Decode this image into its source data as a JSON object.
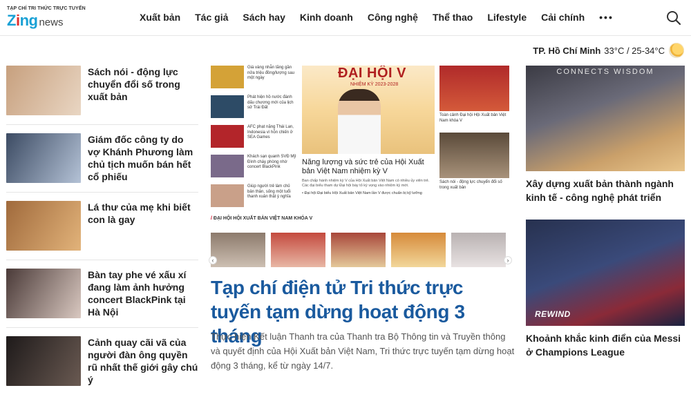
{
  "header": {
    "logo_tag": "TẠP CHÍ TRI THỨC TRỰC TUYẾN",
    "logo_brand_z": "Z",
    "logo_brand_i": "i",
    "logo_brand_ng": "ng",
    "logo_news": "news",
    "nav": [
      "Xuất bản",
      "Tác giả",
      "Sách hay",
      "Kinh doanh",
      "Công nghệ",
      "Thể thao",
      "Lifestyle",
      "Cải chính"
    ],
    "more": "•••"
  },
  "weather": {
    "city": "TP. Hồ Chí Minh",
    "temp": "33°C / 25-34°C"
  },
  "left_news": [
    {
      "title": "Sách nói - động lực chuyển đổi số trong xuất bản",
      "colors": [
        "#c7a07e",
        "#e9d6c3"
      ]
    },
    {
      "title": "Giám đốc công ty do vợ Khánh Phương làm chủ tịch muốn bán hết cổ phiếu",
      "colors": [
        "#3c4b63",
        "#b4c2d6"
      ]
    },
    {
      "title": "Lá thư của mẹ khi biết con là gay",
      "colors": [
        "#a06a3c",
        "#e2b37a"
      ]
    },
    {
      "title": "Bàn tay phe vé xấu xí đang làm ảnh hưởng concert BlackPink tại Hà Nội",
      "colors": [
        "#4a3a38",
        "#d9c8c0"
      ]
    },
    {
      "title": "Cảnh quay cãi vã của người đàn ông quyền rũ nhất thế giới gây chú ý",
      "colors": [
        "#1e1a1a",
        "#6a5a52"
      ]
    }
  ],
  "mini_news": [
    {
      "text": "Giá vàng nhẫn tăng gần nửa triệu đồng/lượng sau một ngày",
      "color": "#d4a237"
    },
    {
      "text": "Phát hiện hồ nước đánh dấu chương mới của lịch sử Trái Đất",
      "color": "#2d4b66"
    },
    {
      "text": "AFC phạt nặng Thái Lan, Indonesia vì hỗn chiến ở SEA Games",
      "color": "#b3252a"
    },
    {
      "text": "Khách sạn quanh SVĐ Mỹ Đình cháy phòng nhờ concert BlackPink",
      "color": "#7a6a8a"
    },
    {
      "text": "Giúp người trẻ làm chủ bản thân, sống một tuổi thanh xuân thật ý nghĩa",
      "color": "#c9a089"
    }
  ],
  "feature": {
    "banner": "ĐẠI HỘI V",
    "banner_sub": "NHIỆM KỲ 2023-2028",
    "title": "Năng lượng và sức trẻ của Hội Xuất bản Việt Nam nhiệm kỳ V",
    "desc": "Ban chấp hành nhiệm kỳ V của Hội Xuất bản Việt Nam có nhiều ủy viên trẻ. Các đại biểu tham dự Đại hội bày tỏ kỳ vọng vào nhiệm kỳ mới.",
    "bullet": "• Đại hội Đại biểu Hội Xuất bản Việt Nam lần V được chuẩn bị kỹ lưỡng"
  },
  "side_news": [
    {
      "caption": "Toàn cảnh Đại hội Hội Xuất bản Việt Nam khóa V",
      "color": "#b02a2a"
    },
    {
      "caption": "Sách nói - động lực chuyển đổi số trong xuất bản",
      "color": "#5a4a3a"
    }
  ],
  "section": {
    "slash": "/",
    "label": "ĐẠI HỘI HỘI XUẤT BẢN VIỆT NAM KHÓA V"
  },
  "strip_colors": [
    "#8c7a6c",
    "#c44a3e",
    "#a8473a",
    "#d68a3a",
    "#b9b2b2"
  ],
  "strip_nav": {
    "prev": "‹",
    "next": "›"
  },
  "main_story": {
    "headline": "Tạp chí điện tử Tri thức trực tuyến tạm dừng hoạt động 3 tháng",
    "summary": "Thực hiện Kết luận Thanh tra của Thanh tra Bộ Thông tin và Truyền thông và quyết định của Hội Xuất bản Việt Nam, Tri thức trực tuyến tạm dừng hoạt động 3 tháng, kể từ ngày 14/7."
  },
  "right_news": [
    {
      "title": "Xây dựng xuất bản thành ngành kinh tế - công nghệ phát triển",
      "image_text": "CONNECTS WISDOM"
    },
    {
      "title": "Khoảnh khắc kinh điển của Messi ở Champions League",
      "image_text": "REWIND"
    }
  ]
}
